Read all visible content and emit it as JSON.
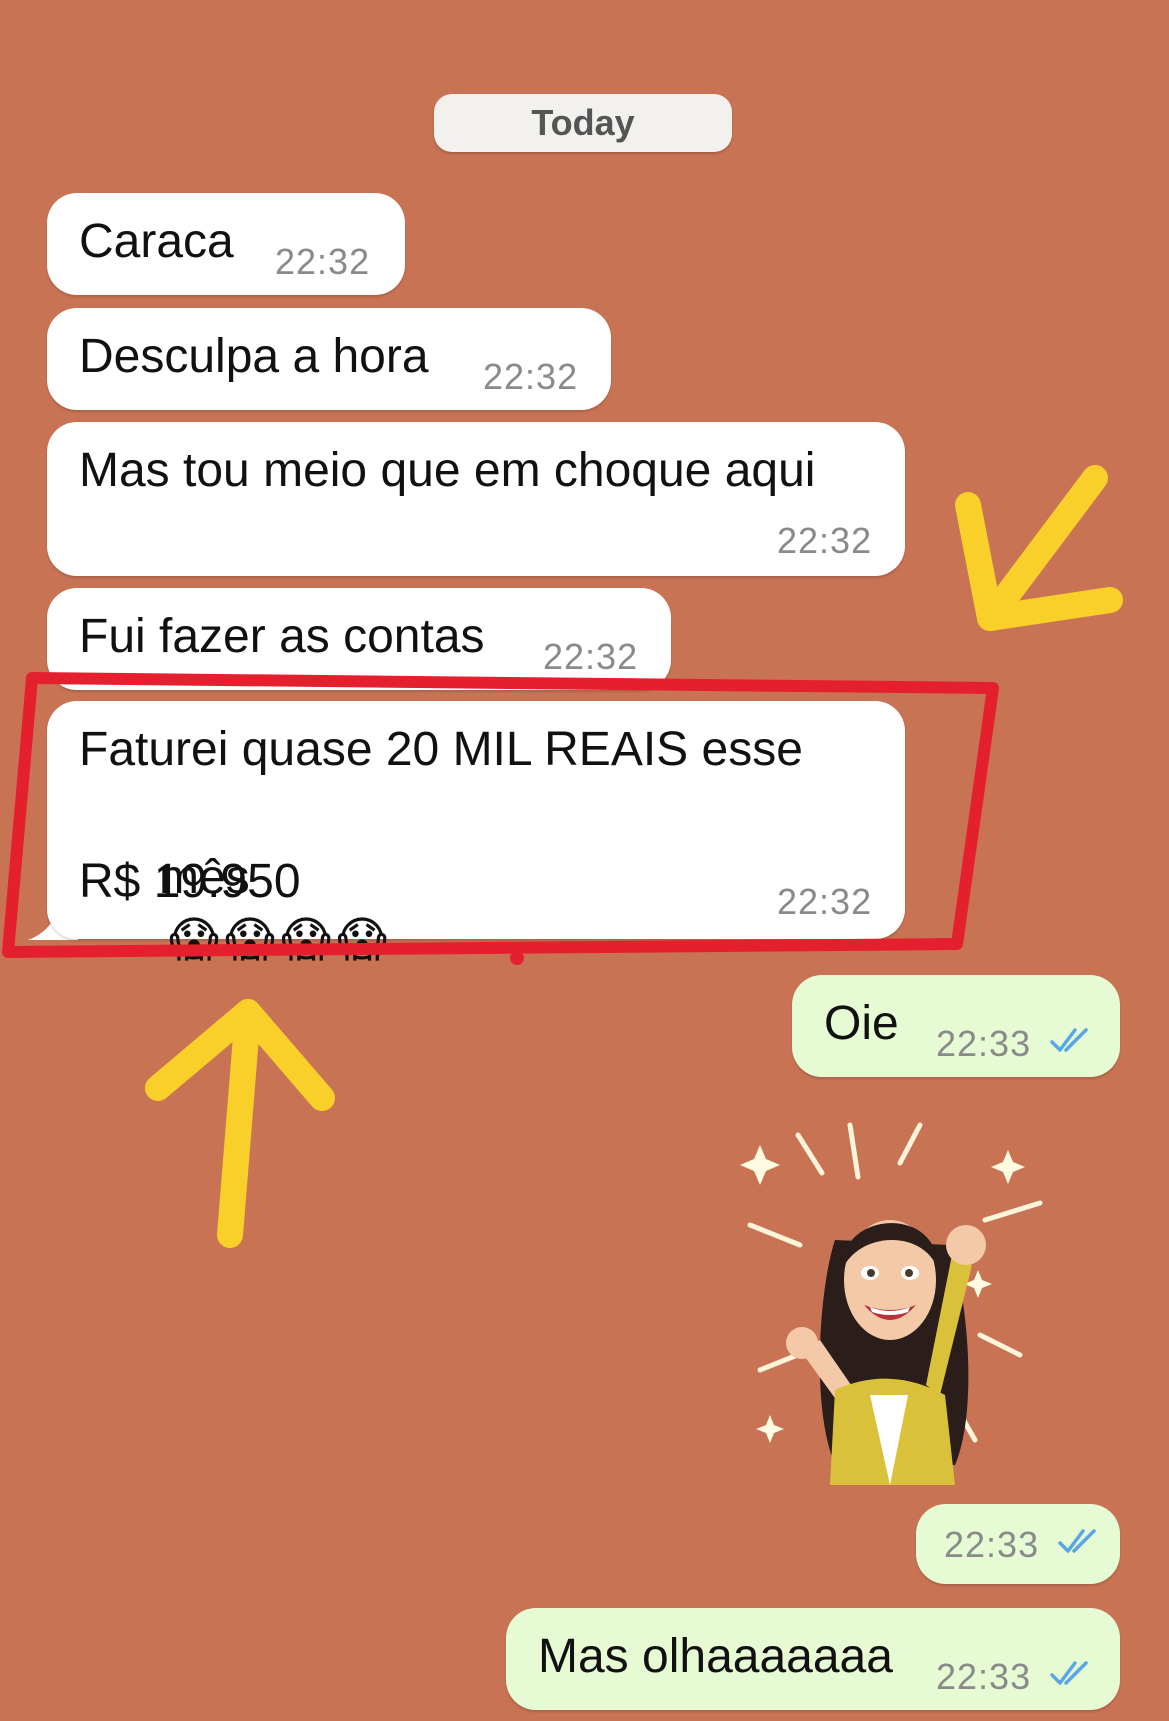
{
  "date_separator": "Today",
  "messages": [
    {
      "id": "m1",
      "direction": "incoming",
      "text": "Caraca",
      "time": "22:32"
    },
    {
      "id": "m2",
      "direction": "incoming",
      "text": "Desculpa a hora",
      "time": "22:32"
    },
    {
      "id": "m3",
      "direction": "incoming",
      "text": "Mas tou meio que em choque aqui",
      "time": "22:32"
    },
    {
      "id": "m4",
      "direction": "incoming",
      "text": "Fui fazer as contas",
      "time": "22:32"
    },
    {
      "id": "m5",
      "direction": "incoming",
      "text_line1": "Faturei quase 20 MIL REAIS esse",
      "text_line2_word": "mês",
      "text_line2_emojis": "😱😱😱😱",
      "text_line3": "R$ 19.950",
      "time": "22:32",
      "highlighted": true
    },
    {
      "id": "m6",
      "direction": "outgoing",
      "text": "Oie",
      "time": "22:33",
      "read": true
    },
    {
      "id": "m7",
      "direction": "outgoing",
      "type": "sticker",
      "sticker": "celebrating-woman-avatar",
      "time": "22:33",
      "read": true
    },
    {
      "id": "m8",
      "direction": "outgoing",
      "text": "Mas olhaaaaaaa",
      "time": "22:33",
      "read": true
    }
  ],
  "colors": {
    "wallpaper": "#c97355",
    "incoming_bubble": "#ffffff",
    "outgoing_bubble": "#e6fbd4",
    "read_ticks": "#5aa7e6",
    "highlight_box": "#e5202e",
    "arrows": "#f9cf2a"
  },
  "annotations": {
    "highlight_box": "red-rectangle-around-earnings-message",
    "arrows": [
      "yellow-arrow-down-left",
      "yellow-arrow-up"
    ]
  }
}
